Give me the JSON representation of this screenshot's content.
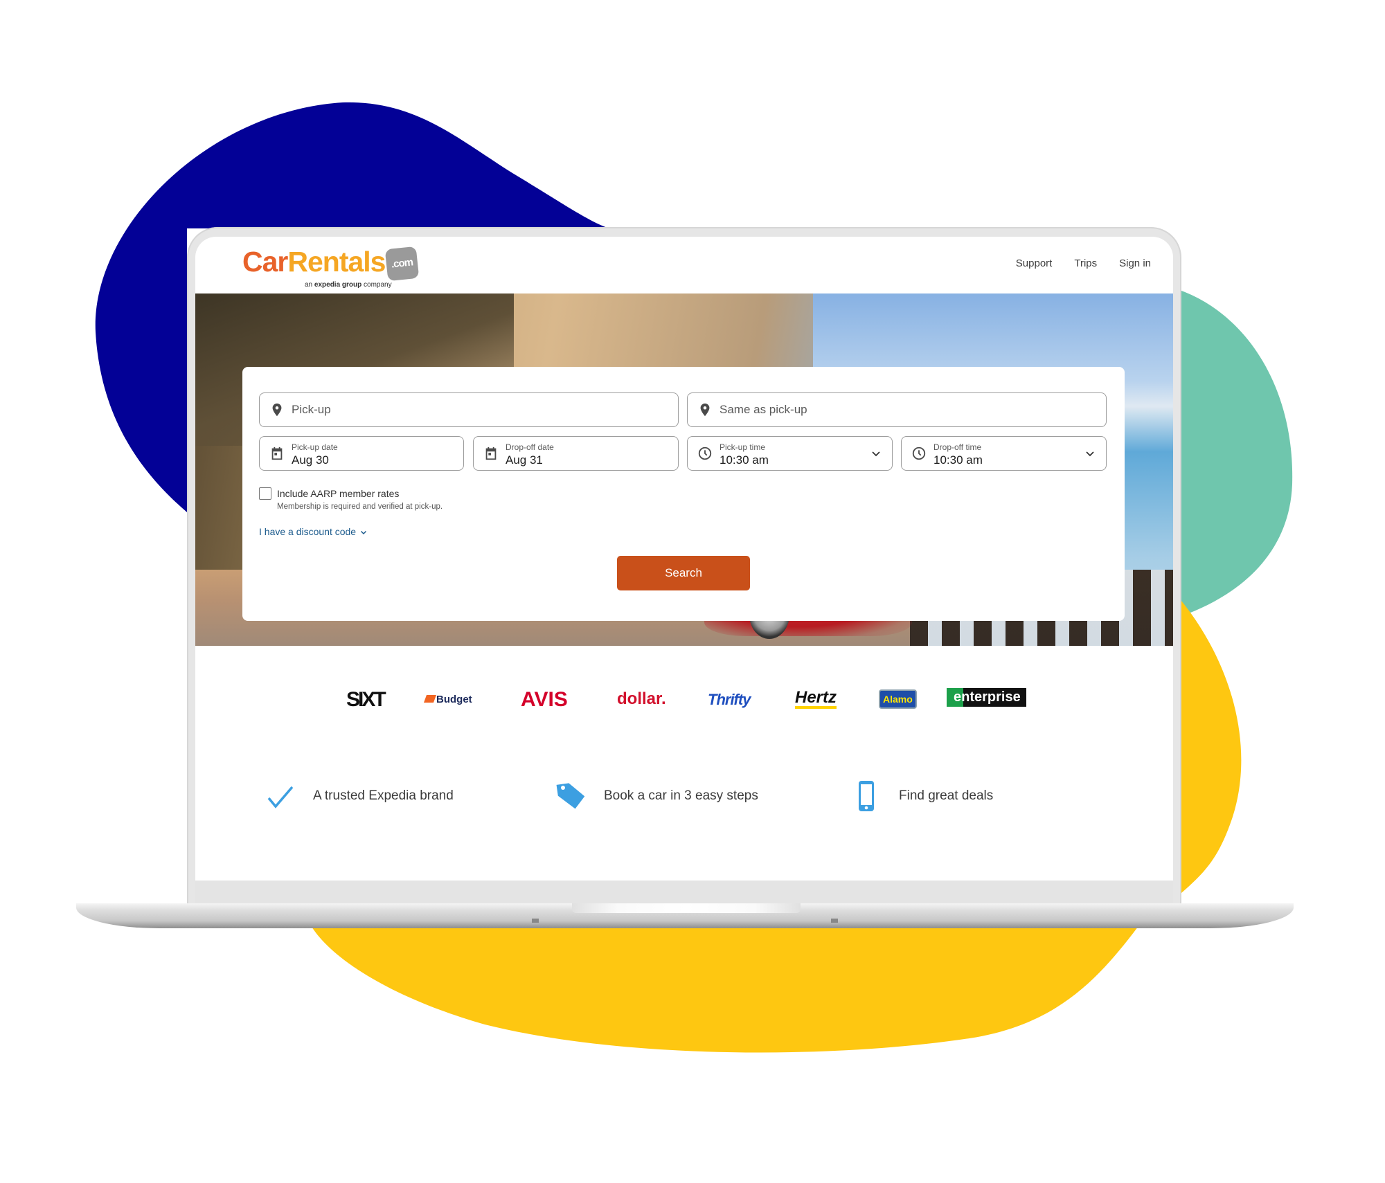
{
  "colors": {
    "blob_blue": "#030196",
    "blob_teal": "#6fc6ad",
    "blob_yellow": "#fec711",
    "brand_orange": "#e8622a",
    "brand_amber": "#f5a623",
    "search_button": "#c9501a",
    "link_blue": "#1b5a8c",
    "feature_icon_blue": "#3c9fe1"
  },
  "header": {
    "logo": {
      "part1": "Car",
      "part2": "Rentals",
      "suffix": ".com",
      "tagline_prefix": "an ",
      "tagline_brand": "expedia group",
      "tagline_suffix": " company"
    },
    "nav": [
      {
        "label": "Support"
      },
      {
        "label": "Trips"
      },
      {
        "label": "Sign in"
      }
    ]
  },
  "search_form": {
    "pickup_location": {
      "placeholder": "Pick-up",
      "icon": "map-pin-icon"
    },
    "dropoff_location": {
      "placeholder": "Same as pick-up",
      "icon": "map-pin-icon"
    },
    "pickup_date": {
      "label": "Pick-up date",
      "value": "Aug 30",
      "icon": "calendar-icon"
    },
    "dropoff_date": {
      "label": "Drop-off date",
      "value": "Aug 31",
      "icon": "calendar-icon"
    },
    "pickup_time": {
      "label": "Pick-up time",
      "value": "10:30 am",
      "icon": "clock-icon"
    },
    "dropoff_time": {
      "label": "Drop-off time",
      "value": "10:30 am",
      "icon": "clock-icon"
    },
    "aarp": {
      "label": "Include AARP member rates",
      "note": "Membership is required and verified at pick-up.",
      "checked": false
    },
    "discount_link": "I have a discount code",
    "search_button": "Search"
  },
  "brands": [
    {
      "name": "SIXT",
      "color": "#111111"
    },
    {
      "name": "Budget",
      "color": "#1c2a5b"
    },
    {
      "name": "AVIS",
      "color": "#d4002a"
    },
    {
      "name": "dollar.",
      "color": "#d2102c"
    },
    {
      "name": "Thrifty",
      "color": "#1f4fbf"
    },
    {
      "name": "Hertz",
      "color": "#111111"
    },
    {
      "name": "Alamo",
      "color": "#1e4ea8"
    },
    {
      "name": "enterprise",
      "color": "#ffffff"
    }
  ],
  "features": [
    {
      "icon": "checkmark-icon",
      "label": "A trusted Expedia brand"
    },
    {
      "icon": "price-tag-icon",
      "label": "Book a car in 3 easy steps"
    },
    {
      "icon": "smartphone-icon",
      "label": "Find great deals"
    }
  ]
}
